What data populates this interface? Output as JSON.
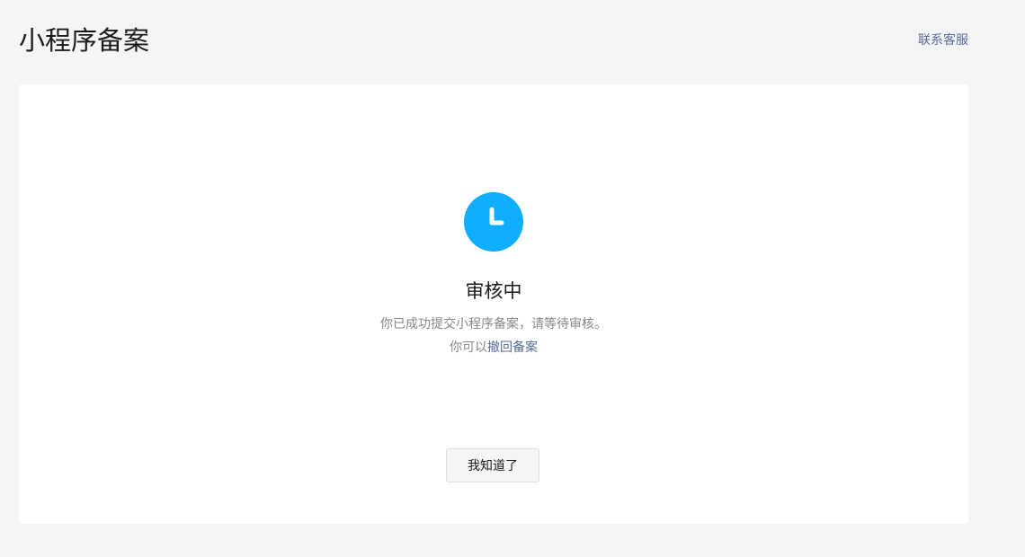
{
  "header": {
    "title": "小程序备案",
    "support_link": "联系客服"
  },
  "status": {
    "icon": "clock-icon",
    "icon_color": "#10aeff",
    "title": "审核中",
    "desc_line1": "你已成功提交小程序备案，请等待审核。",
    "desc_line2_prefix": "你可以",
    "withdraw_link": "撤回备案"
  },
  "actions": {
    "ok_label": "我知道了"
  },
  "colors": {
    "background": "#f4f5f7",
    "card": "#ffffff",
    "link": "#576b95",
    "text_primary": "#1a1a1a",
    "text_secondary": "#888888"
  }
}
